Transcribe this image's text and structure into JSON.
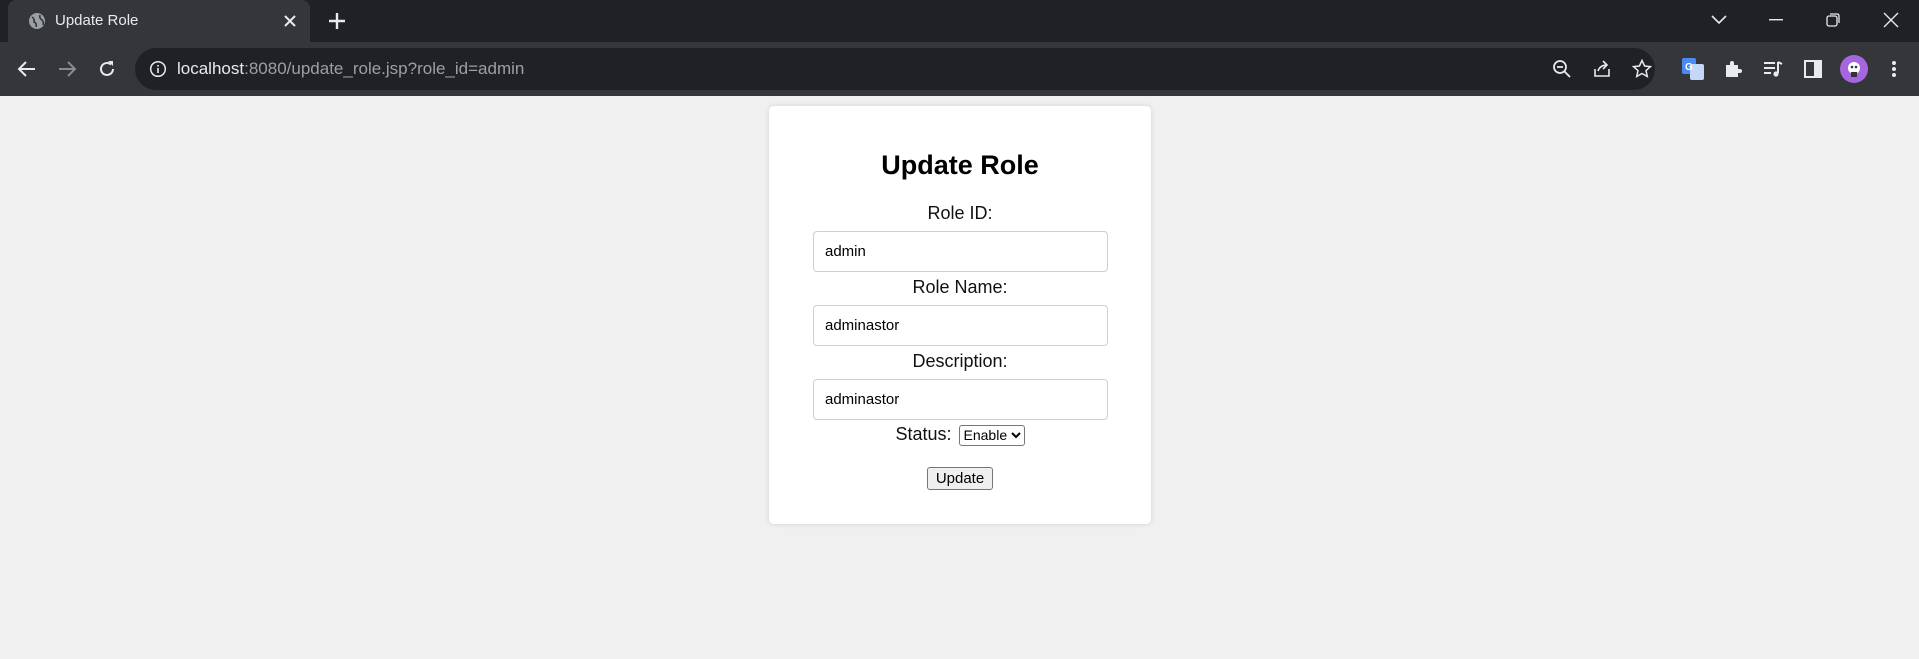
{
  "browser": {
    "tab_title": "Update Role",
    "url_host": "localhost",
    "url_rest": ":8080/update_role.jsp?role_id=admin"
  },
  "form": {
    "heading": "Update Role",
    "role_id_label": "Role ID:",
    "role_id_value": "admin",
    "role_name_label": "Role Name:",
    "role_name_value": "adminastor",
    "description_label": "Description:",
    "description_value": "adminastor",
    "status_label": "Status:",
    "status_selected": "Enable",
    "update_label": "Update"
  },
  "colors": {
    "tabstrip": "#202124",
    "toolbar": "#35363a",
    "page_background": "#f0f0f0",
    "card": "#ffffff",
    "avatar": "#a566e0"
  },
  "icons": [
    "globe-icon",
    "close-icon",
    "plus-icon",
    "chevron-down-icon",
    "minimize-icon",
    "restore-icon",
    "back-icon",
    "forward-icon",
    "reload-icon",
    "info-icon",
    "zoom-out-icon",
    "share-icon",
    "star-icon",
    "translate-icon",
    "extensions-icon",
    "media-icon",
    "sidepanel-icon",
    "menu-icon"
  ]
}
